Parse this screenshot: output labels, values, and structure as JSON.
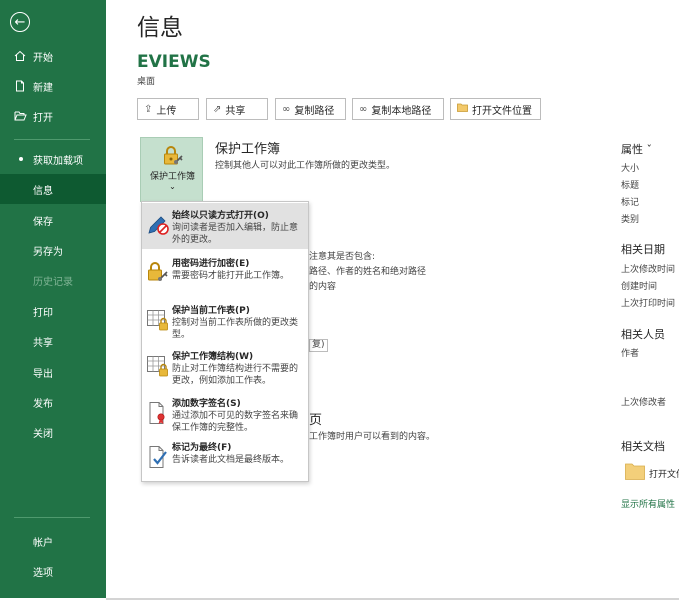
{
  "sidebar": {
    "back_icon": "arrow-left-icon",
    "items": [
      {
        "label": "开始",
        "icon": "home-icon"
      },
      {
        "label": "新建",
        "icon": "new-file-icon"
      },
      {
        "label": "打开",
        "icon": "folder-open-icon"
      },
      {
        "label": "获取加载项"
      },
      {
        "label": "信息"
      },
      {
        "label": "保存"
      },
      {
        "label": "另存为"
      },
      {
        "label": "历史记录"
      },
      {
        "label": "打印"
      },
      {
        "label": "共享"
      },
      {
        "label": "导出"
      },
      {
        "label": "发布"
      },
      {
        "label": "关闭"
      }
    ],
    "bottom": [
      {
        "label": "帐户"
      },
      {
        "label": "选项"
      }
    ],
    "active": "信息",
    "disabled": "历史记录"
  },
  "main": {
    "title": "信息",
    "file_name": "EVIEWS",
    "file_path": "桌面",
    "toolbar": [
      {
        "label": "上传",
        "icon": "upload-icon"
      },
      {
        "label": "共享",
        "icon": "share-icon"
      },
      {
        "label": "复制路径",
        "icon": "link-icon"
      },
      {
        "label": "复制本地路径",
        "icon": "link-icon"
      },
      {
        "label": "打开文件位置",
        "icon": "folder-icon"
      }
    ],
    "protect": {
      "tile_label": "保护工作簿",
      "title": "保护工作簿",
      "desc": "控制其他人可以对此工作簿所做的更改类型。"
    },
    "behind": {
      "l1": "注意其是否包含:",
      "l2": "路径、作者的姓名和绝对路径",
      "l3": "的内容",
      "l4": "复)",
      "l5": "页",
      "l6": "工作簿时用户可以看到的内容。"
    }
  },
  "dropdown": [
    {
      "title": "始终以只读方式打开(O)",
      "desc": "询问读者是否加入编辑，防止意外的更改。",
      "icon": "pencil-no-icon"
    },
    {
      "title": "用密码进行加密(E)",
      "desc": "需要密码才能打开此工作簿。",
      "icon": "lock-key-icon"
    },
    {
      "title": "保护当前工作表(P)",
      "desc": "控制对当前工作表所做的更改类型。",
      "icon": "sheet-lock-icon"
    },
    {
      "title": "保护工作簿结构(W)",
      "desc": "防止对工作簿结构进行不需要的更改，例如添加工作表。",
      "icon": "workbook-lock-icon"
    },
    {
      "title": "添加数字签名(S)",
      "desc": "通过添加不可见的数字签名来确保工作簿的完整性。",
      "icon": "signature-icon"
    },
    {
      "title": "标记为最终(F)",
      "desc": "告诉读者此文档是最终版本。",
      "icon": "final-check-icon"
    }
  ],
  "right": {
    "props_heading": "属性 ˇ",
    "props": [
      "大小",
      "标题",
      "标记",
      "类别"
    ],
    "dates_heading": "相关日期",
    "dates": [
      "上次修改时间",
      "创建时间",
      "上次打印时间"
    ],
    "people_heading": "相关人员",
    "author": "作者",
    "last_modified_by": "上次修改者",
    "docs_heading": "相关文档",
    "open_file": "打开文件",
    "show_all": "显示所有属性"
  }
}
